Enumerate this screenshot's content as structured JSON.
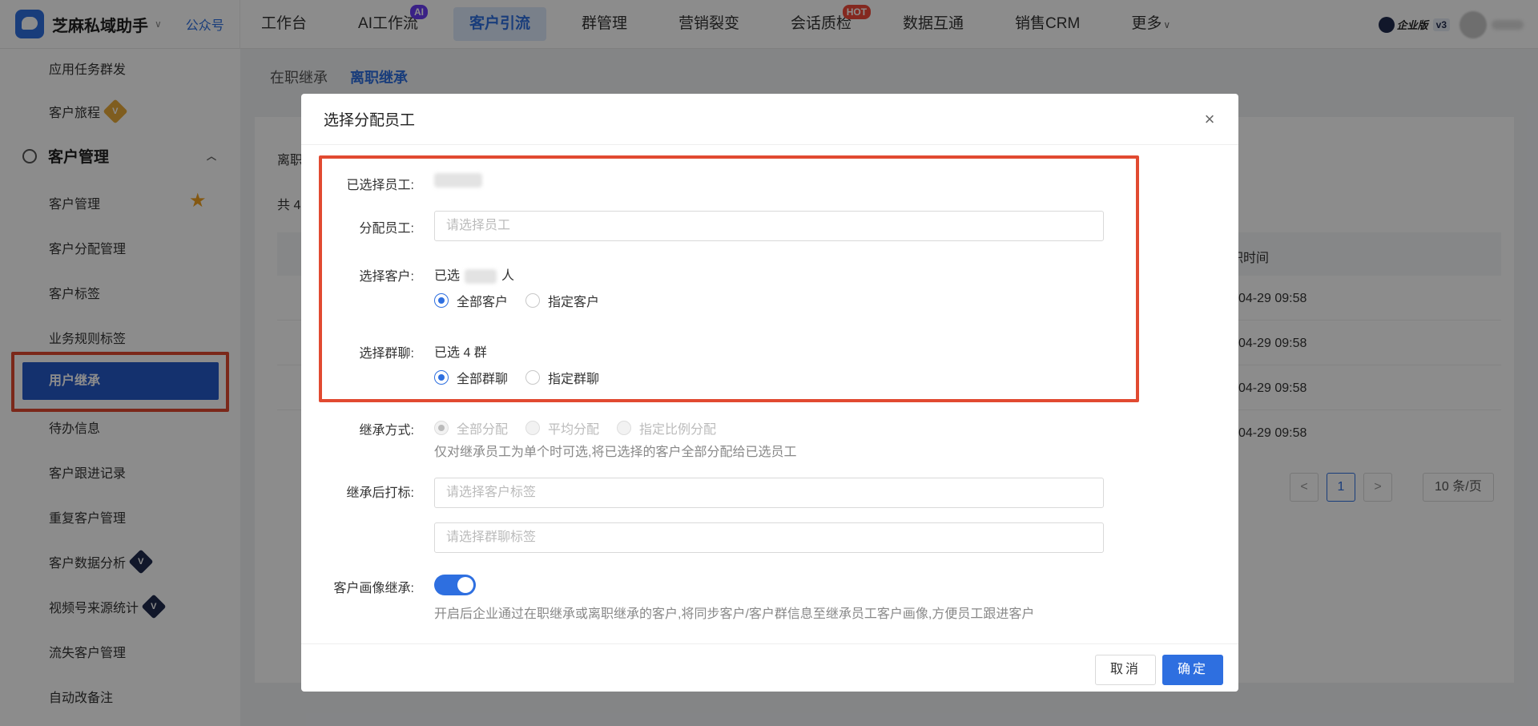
{
  "topbar": {
    "brand": "芝麻私域助手",
    "brand_caret": "∨",
    "brand_link": "公众号",
    "nav": [
      {
        "label": "工作台",
        "badge": ""
      },
      {
        "label": "AI工作流",
        "badge": "AI"
      },
      {
        "label": "客户引流",
        "badge": ""
      },
      {
        "label": "群管理",
        "badge": ""
      },
      {
        "label": "营销裂变",
        "badge": ""
      },
      {
        "label": "会话质检",
        "badge": "HOT"
      },
      {
        "label": "数据互通",
        "badge": ""
      },
      {
        "label": "销售CRM",
        "badge": ""
      },
      {
        "label": "更多",
        "badge": ""
      }
    ],
    "active_nav": "客户引流",
    "edition": "企业版",
    "edition_version": "v3"
  },
  "sidebar": {
    "items_top": [
      "应用任务群发",
      "客户旅程"
    ],
    "group_title": "客户管理",
    "items": [
      "客户管理",
      "客户分配管理",
      "客户标签",
      "业务规则标签",
      "用户继承",
      "待办信息",
      "客户跟进记录",
      "重复客户管理",
      "客户数据分析",
      "视频号来源统计",
      "流失客户管理",
      "自动改备注"
    ],
    "active": "用户继承",
    "tag_v": "V"
  },
  "main": {
    "tabs": [
      "在职继承",
      "离职继承"
    ],
    "active_tab": "离职继承",
    "card_title_fragment": "离职",
    "count_fragment": "共 4",
    "col_time_fragment": "职时间",
    "row_times": [
      "04-29 09:58",
      "04-29 09:58",
      "04-29 09:58",
      "04-29 09:58"
    ],
    "pager": {
      "prev": "<",
      "current": "1",
      "next": ">",
      "page_size": "10 条/页"
    }
  },
  "modal": {
    "title": "选择分配员工",
    "close": "×",
    "selected_staff_label": "已选择员工:",
    "assign_label": "分配员工:",
    "assign_placeholder": "请选择员工",
    "customers_label": "选择客户:",
    "customers_prefix": "已选",
    "customers_suffix": "人",
    "customers_options": [
      "全部客户",
      "指定客户"
    ],
    "groups_label": "选择群聊:",
    "groups_value": "已选 4 群",
    "groups_options": [
      "全部群聊",
      "指定群聊"
    ],
    "method_label": "继承方式:",
    "method_options": [
      "全部分配",
      "平均分配",
      "指定比例分配"
    ],
    "method_hint": "仅对继承员工为单个时可选,将已选择的客户全部分配给已选员工",
    "tag_label": "继承后打标:",
    "tag_customer_placeholder": "请选择客户标签",
    "tag_group_placeholder": "请选择群聊标签",
    "portrait_label": "客户画像继承:",
    "portrait_hint": "开启后企业通过在职继承或离职继承的客户,将同步客户/客户群信息至继承员工客户画像,方便员工跟进客户",
    "portrait_enabled": true,
    "cancel": "取消",
    "ok": "确定"
  }
}
